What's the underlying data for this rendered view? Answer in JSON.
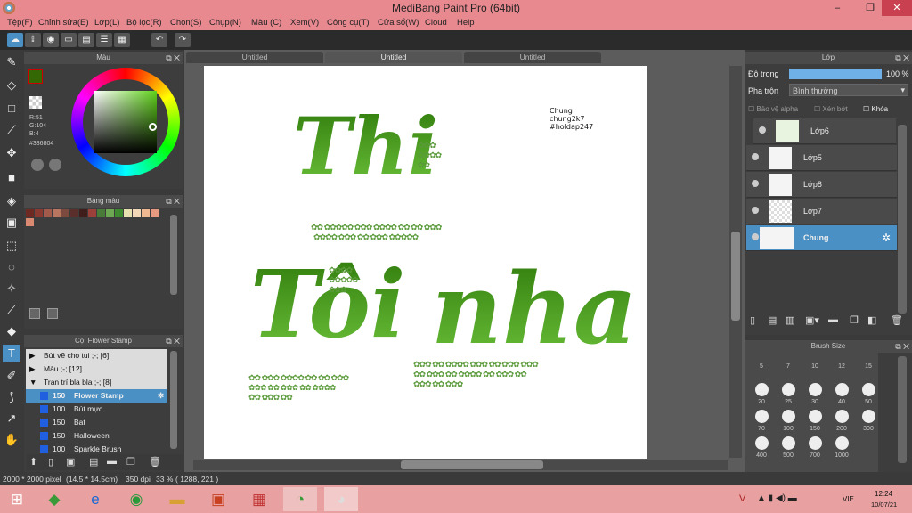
{
  "window": {
    "title": "MediBang Paint Pro (64bit)"
  },
  "menu": [
    "Tệp(F)",
    "Chỉnh sửa(E)",
    "Lớp(L)",
    "Bộ lọc(R)",
    "Chọn(S)",
    "Chụp(N)",
    "Màu (C)",
    "Xem(V)",
    "Công cụ(T)",
    "Cửa sổ(W)",
    "Cloud",
    "Help"
  ],
  "color_panel": {
    "title": "Màu",
    "r": "R:51",
    "g": "G:104",
    "b": "B:4",
    "hex": "#336804",
    "fg": "#336804"
  },
  "palette_panel": {
    "title": "Bảng màu"
  },
  "brush_panel": {
    "title": "Cọ: Flower Stamp",
    "groups": [
      "Bút vẽ cho tui ;-; [6]",
      "Màu ;-; [12]",
      "Tran trí bla bla ;-; [8]"
    ],
    "items": [
      {
        "size": "150",
        "name": "Flower Stamp"
      },
      {
        "size": "100",
        "name": "Bút mực"
      },
      {
        "size": "150",
        "name": "Bat"
      },
      {
        "size": "150",
        "name": "Halloween"
      },
      {
        "size": "100",
        "name": "Sparkle Brush"
      }
    ]
  },
  "tabs": [
    "Untitled",
    "Untitled",
    "Untitled"
  ],
  "canvas": {
    "word1": "Thi",
    "word2": "Tôi",
    "word3": "nha",
    "sig": [
      "Chung",
      "chung2k7",
      "#holdap247"
    ]
  },
  "layer_panel": {
    "title": "Lớp",
    "opacity_label": "Độ trong",
    "opacity": "100 %",
    "opacity_value": 100,
    "blend_label": "Pha trộn",
    "blend": "Bình thường",
    "protect": "Bảo vệ alpha",
    "clip": "Xén bớt",
    "lock": "Khóa",
    "layers": [
      "Lớp6",
      "Lớp5",
      "Lớp8",
      "Lớp7",
      "Chung"
    ]
  },
  "brush_size_panel": {
    "title": "Brush Size",
    "sizes": [
      "5",
      "7",
      "10",
      "12",
      "15",
      "20",
      "25",
      "30",
      "40",
      "50",
      "70",
      "100",
      "150",
      "200",
      "300",
      "400",
      "500",
      "700",
      "1000"
    ]
  },
  "status": {
    "size": "2000 * 2000 pixel",
    "cm": "(14.5 * 14.5cm)",
    "dpi": "350 dpi",
    "zoom": "33 %",
    "pos": "( 1288, 221 )"
  },
  "taskbar": {
    "lang": "VIE",
    "time": "12:24",
    "date": "10/07/21"
  }
}
